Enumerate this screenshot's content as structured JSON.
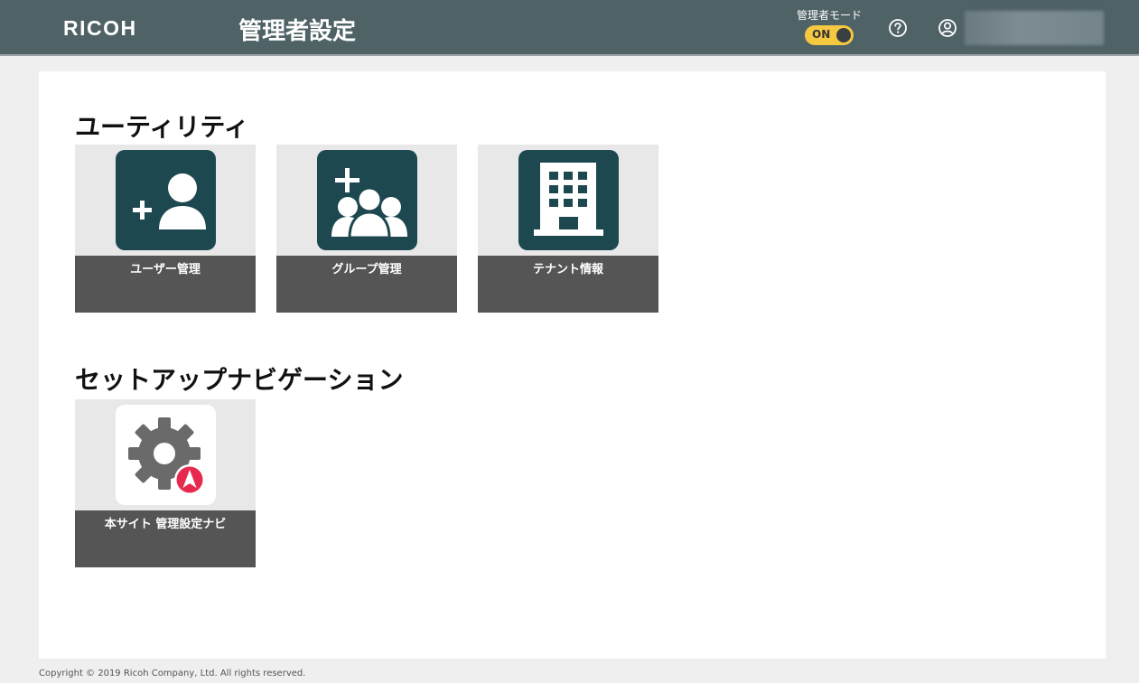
{
  "header": {
    "logo": "RICOH",
    "title": "管理者設定",
    "admin_mode_label": "管理者モード",
    "admin_mode_toggle": "ON"
  },
  "sections": [
    {
      "title": "ユーティリティ",
      "tiles": [
        {
          "label": "ユーザー管理",
          "icon": "add-user-icon"
        },
        {
          "label": "グループ管理",
          "icon": "add-group-icon"
        },
        {
          "label": "テナント情報",
          "icon": "building-icon"
        }
      ]
    },
    {
      "title": "セットアップナビゲーション",
      "tiles": [
        {
          "label": "本サイト 管理設定ナビ",
          "icon": "gear-navigation-icon"
        }
      ]
    }
  ],
  "footer": {
    "copyright": "Copyright © 2019 Ricoh Company, Ltd. All rights reserved."
  },
  "colors": {
    "header_bg": "#4f6266",
    "tile_icon_bg": "#1d4850",
    "tile_label_bg": "#555555",
    "toggle_on": "#f5c842",
    "nav_badge": "#e8294f"
  }
}
